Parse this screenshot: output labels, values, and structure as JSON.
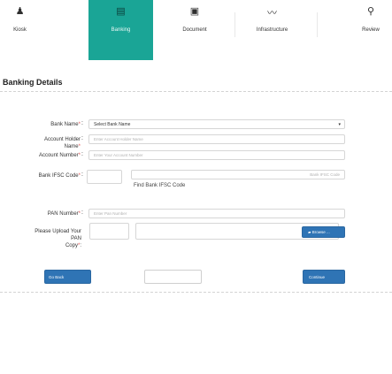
{
  "steps": [
    {
      "label": "Kiosk",
      "icon": "user-icon",
      "glyph": "♟"
    },
    {
      "label": "Banking",
      "icon": "document-icon",
      "glyph": "▤"
    },
    {
      "label": "Document",
      "icon": "image-icon",
      "glyph": "▣"
    },
    {
      "label": "Infrastructure",
      "icon": "line-chart-icon",
      "glyph": "〰"
    },
    {
      "label": "Review",
      "icon": "map-marker-icon",
      "glyph": "⚲"
    }
  ],
  "section_title": "Banking Details",
  "form": {
    "bank_name_label": "Bank Name",
    "bank_name_value": "Select Bank Name",
    "holder_label": "Account Holder Name",
    "holder_placeholder": "Enter Account Holder Name",
    "account_number_label": "Account Number",
    "account_number_placeholder": "Enter Your Account Number",
    "ifsc_label": "Bank IFSC Code",
    "ifsc_placeholder": "Bank IFSC Code",
    "find_ifsc_link": "Find Bank IFSC Code",
    "pan_label": "PAN Number",
    "pan_placeholder": "Enter Pan Number",
    "upload_label_1": "Please Upload Your PAN",
    "upload_label_2": "Copy",
    "browse_label": "Browse ..."
  },
  "buttons": {
    "go_back": "Go Back",
    "continue": "Continue"
  }
}
